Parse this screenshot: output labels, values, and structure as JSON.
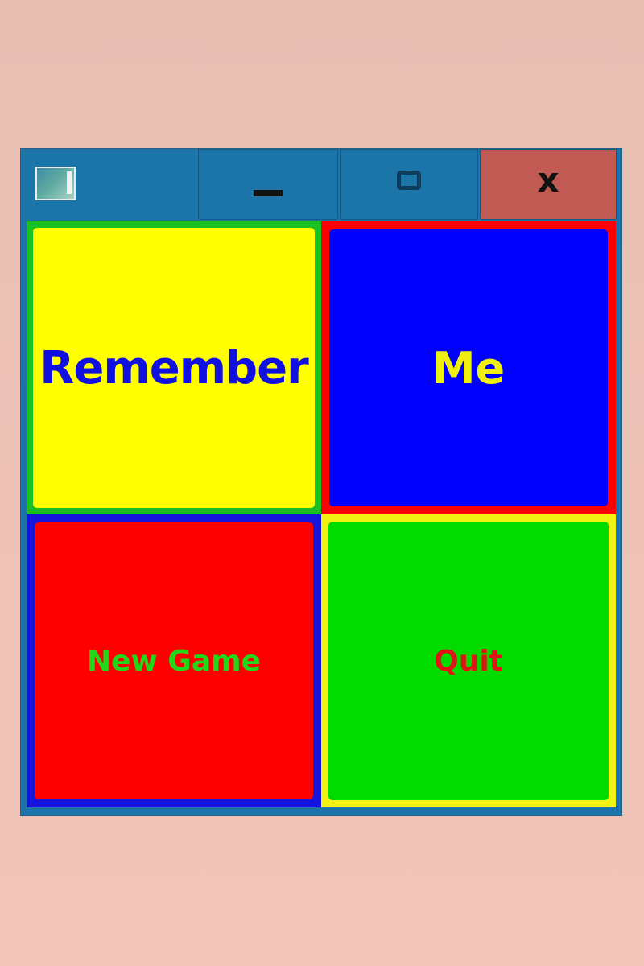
{
  "window": {
    "titlebar": {
      "app_icon": "app-window-icon",
      "minimize_icon": "minimize-icon",
      "maximize_icon": "maximize-icon",
      "close_icon": "close-icon",
      "close_label": "x",
      "colors": {
        "titlebar": "#1b75a9",
        "close_background": "#c05a52"
      }
    },
    "tiles": [
      {
        "label": "Remember",
        "background": "#ffff00",
        "border": "#18c020",
        "text_color": "#1010e0"
      },
      {
        "label": "Me",
        "background": "#0000ff",
        "border": "#ff0000",
        "text_color": "#f0f010"
      },
      {
        "label": "New Game",
        "background": "#ff0000",
        "border": "#1414dc",
        "text_color": "#22d61a"
      },
      {
        "label": "Quit",
        "background": "#00dc00",
        "border": "#f2f214",
        "text_color": "#e01414"
      }
    ]
  }
}
